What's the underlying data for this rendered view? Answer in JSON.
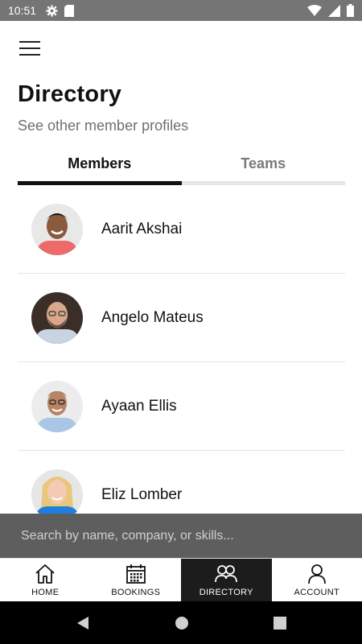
{
  "status_bar": {
    "time": "10:51"
  },
  "header": {
    "title": "Directory",
    "subtitle": "See other member profiles"
  },
  "tabs": [
    {
      "label": "Members",
      "active": true
    },
    {
      "label": "Teams",
      "active": false
    }
  ],
  "members": [
    {
      "name": "Aarit Akshai"
    },
    {
      "name": "Angelo Mateus"
    },
    {
      "name": "Ayaan Ellis"
    },
    {
      "name": "Eliz Lomber"
    }
  ],
  "search": {
    "placeholder": "Search by name, company, or skills..."
  },
  "bottom_nav": [
    {
      "label": "HOME",
      "icon": "home-icon"
    },
    {
      "label": "BOOKINGS",
      "icon": "calendar-icon"
    },
    {
      "label": "DIRECTORY",
      "icon": "people-icon",
      "active": true
    },
    {
      "label": "ACCOUNT",
      "icon": "person-icon"
    }
  ],
  "colors": {
    "active_tab": "#111111",
    "search_bar_bg": "#5e5e5e",
    "active_nav_bg": "#1c1c1c"
  }
}
